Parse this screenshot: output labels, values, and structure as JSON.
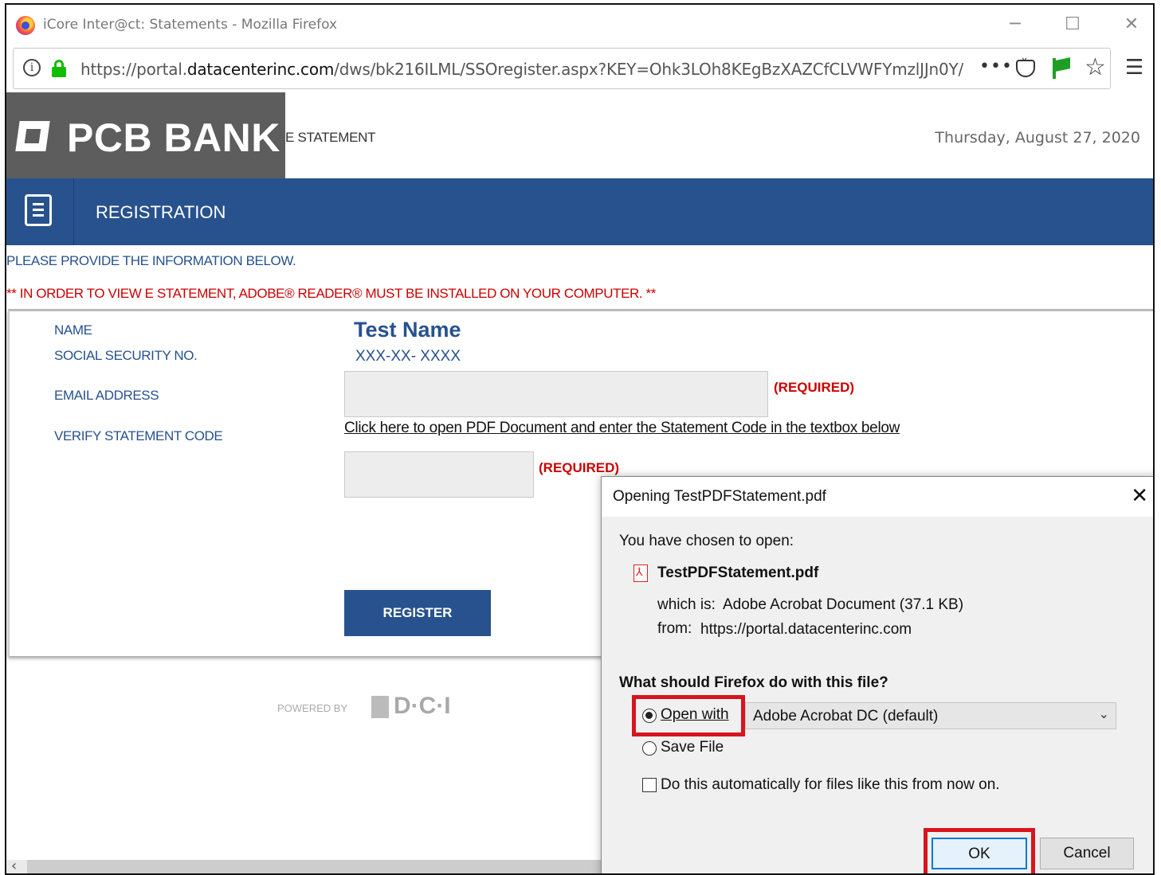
{
  "browser": {
    "window_title": "iCore Inter@ct: Statements - Mozilla Firefox",
    "url_prefix": "https://portal.",
    "url_domain": "datacenterinc.com",
    "url_path": "/dws/bk216ILML/SSOregister.aspx?KEY=Ohk3LOh8KEgBzXAZCfCLVWFYmzlJJn0Y/",
    "more_label": "•••",
    "minimize_icon": "─",
    "maximize_icon": "☐",
    "close_icon": "✕",
    "menu_icon": "☰",
    "star_icon": "☆"
  },
  "header": {
    "bank_name": "PCB BANK",
    "statement_tag": "E STATEMENT",
    "date": "Thursday, August 27, 2020"
  },
  "registration": {
    "title": "REGISTRATION",
    "provide_info": "PLEASE PROVIDE THE INFORMATION BELOW.",
    "warning": "** IN ORDER TO VIEW E STATEMENT, ADOBE® READER® MUST BE INSTALLED ON YOUR COMPUTER. **"
  },
  "form": {
    "name_label": "NAME",
    "ssn_label": "SOCIAL SECURITY NO.",
    "email_label": "EMAIL ADDRESS",
    "verify_label": "VERIFY STATEMENT CODE",
    "name_value": "Test Name",
    "ssn_value": "XXX-XX- XXXX",
    "email_value": "",
    "code_value": "",
    "required_label": "(REQUIRED)",
    "pdf_link": "Click here to open PDF Document and enter the Statement Code in the textbox below",
    "register_button": "REGISTER"
  },
  "footer": {
    "powered_by": "POWERED BY",
    "dci_logo": "D·C·I"
  },
  "dialog": {
    "title": "Opening TestPDFStatement.pdf",
    "close_icon": "✕",
    "chosen_text": "You have chosen to open:",
    "file_name": "TestPDFStatement.pdf",
    "which_is_label": "which is:",
    "which_is_value": "Adobe Acrobat Document (37.1 KB)",
    "from_label": "from:",
    "from_value": "https://portal.datacenterinc.com",
    "question": "What should Firefox do with this file?",
    "open_with_label": "Open with",
    "open_with_app": "Adobe Acrobat DC  (default)",
    "save_file_label": "Save File",
    "auto_label": "Do this automatically for files like this from now on.",
    "ok_button": "OK",
    "cancel_button": "Cancel",
    "selected_option": "open_with",
    "auto_checked": false
  }
}
